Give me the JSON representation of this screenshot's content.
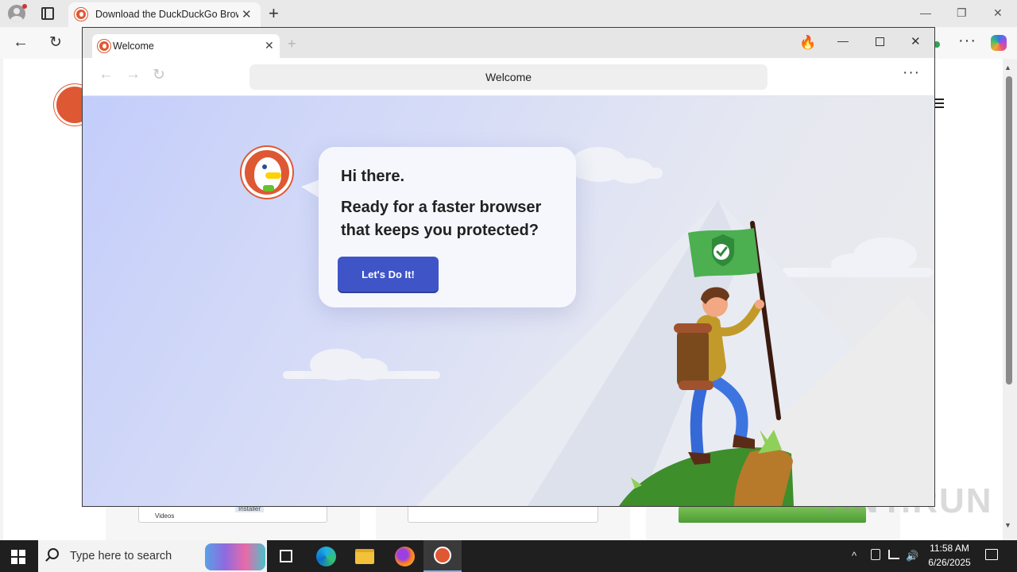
{
  "edge": {
    "tab_title": "Download the DuckDuckGo Browser",
    "icons": {
      "profile": "profile-icon",
      "tab_actions": "tab-actions-icon",
      "new_tab": "plus-icon",
      "back": "arrow-left-icon",
      "reload": "reload-icon",
      "more": "more-icon",
      "copilot": "copilot-icon"
    },
    "tab_close": "✕",
    "new_tab": "+",
    "back": "←",
    "reload": "↻",
    "more": "···",
    "window_min": "—",
    "window_restore": "❐",
    "window_close": "✕",
    "page": {
      "thumb_label_videos": "Videos",
      "thumb_label_installer": "Installer"
    }
  },
  "ddg_window": {
    "tab_title": "Welcome",
    "tab_close": "✕",
    "new_tab": "+",
    "address": "Welcome",
    "fire": "🔥",
    "min": "—",
    "close": "✕",
    "back": "←",
    "forward": "→",
    "reload": "↻",
    "more": "···",
    "welcome": {
      "greeting": "Hi there.",
      "pitch": "Ready for a faster browser that keeps you protected?",
      "cta": "Let's Do It!"
    }
  },
  "taskbar": {
    "search_placeholder": "Type here to search",
    "time": "11:58 AM",
    "date": "6/26/2025",
    "tray_chevron": "^",
    "tray_volume": "🔊"
  },
  "watermark": "ANY.RUN",
  "colors": {
    "cta_blue": "#3f55c7",
    "ddg_orange": "#de5833",
    "flag_green": "#4caf50"
  }
}
